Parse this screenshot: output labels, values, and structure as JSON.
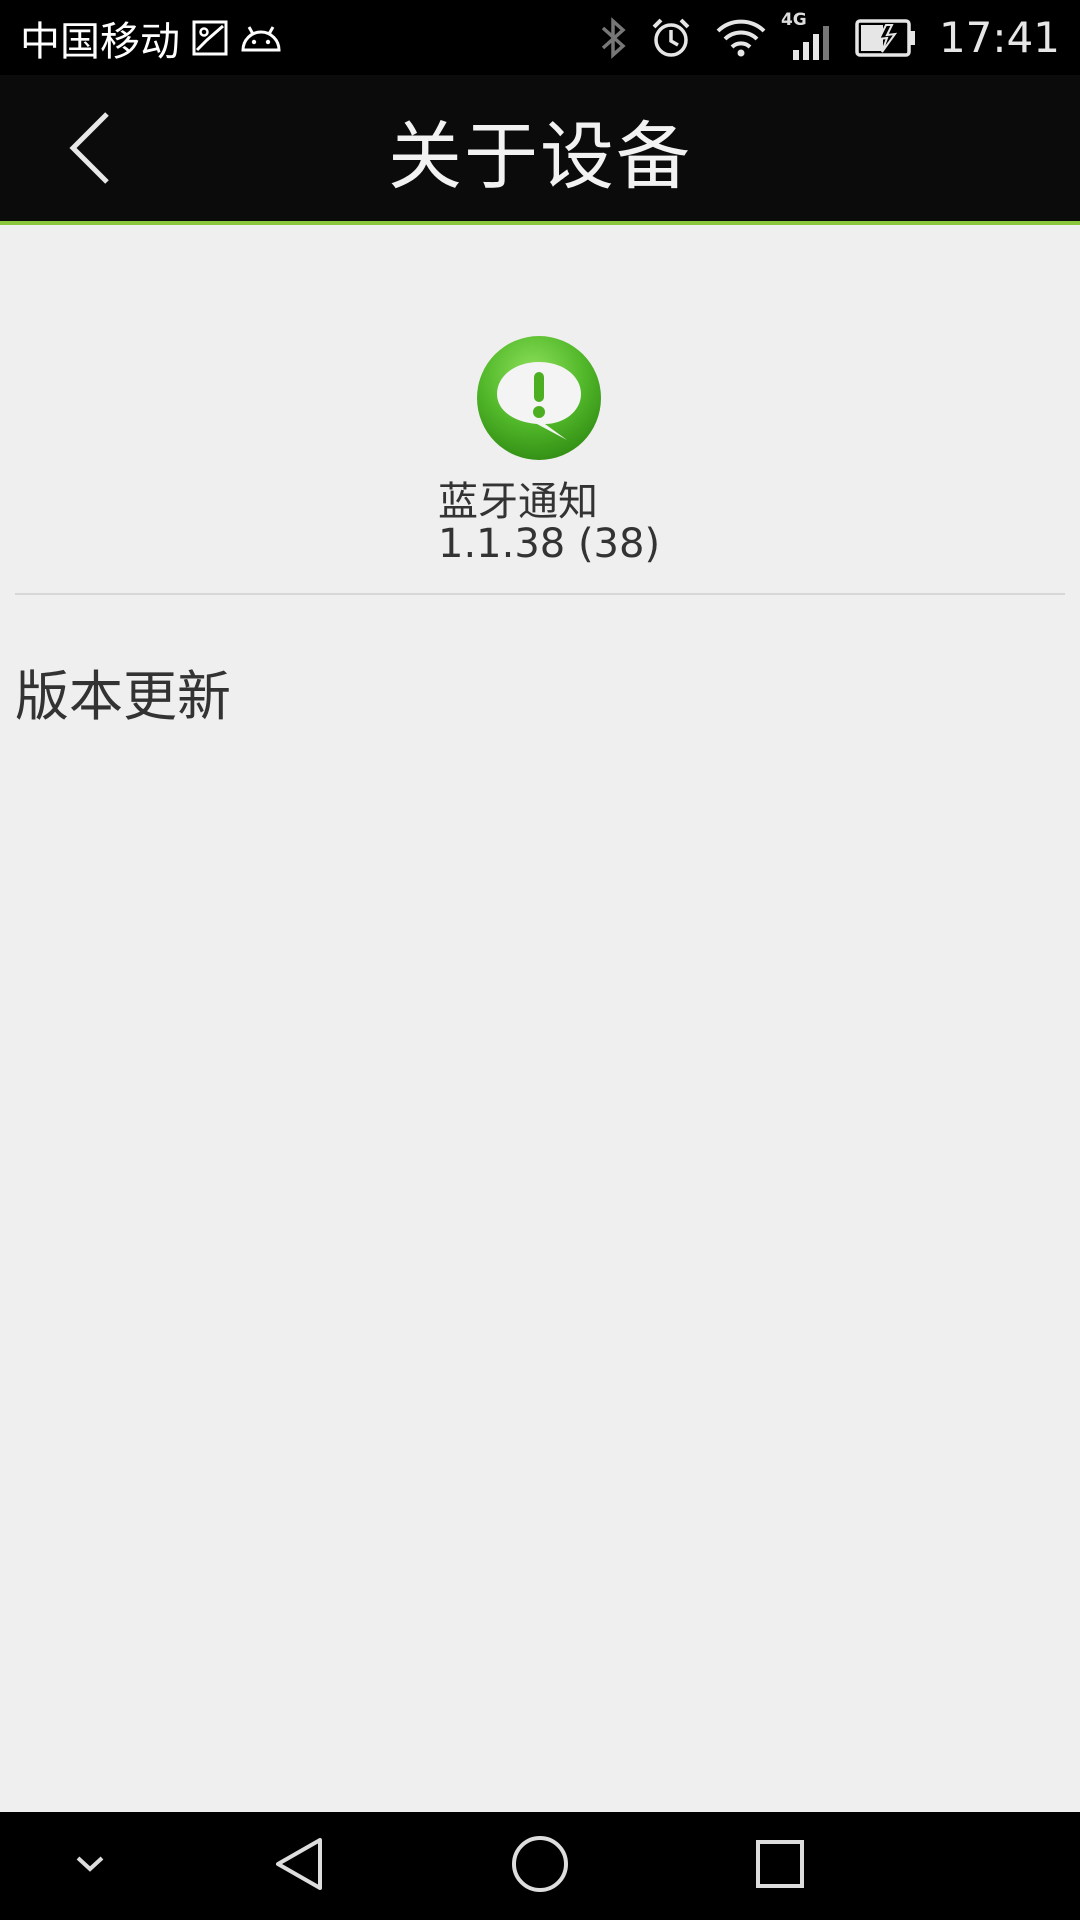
{
  "status_bar": {
    "carrier": "中国移动",
    "network_type": "4G",
    "time": "17:41",
    "icons": [
      "image-icon",
      "android-icon",
      "bluetooth-icon",
      "alarm-icon",
      "wifi-icon",
      "signal-icon",
      "battery-icon"
    ]
  },
  "app_bar": {
    "title": "关于设备",
    "back_icon": "back-arrow-icon",
    "accent_color": "#8cc63f"
  },
  "app_info": {
    "icon": "notification-bubble-icon",
    "icon_color": "#4caf22",
    "name": "蓝牙通知",
    "version": "1.1.38 (38)"
  },
  "menu": {
    "update_label": "版本更新"
  },
  "nav_bar": {
    "icons": [
      "collapse-icon",
      "back-icon",
      "home-icon",
      "recents-icon"
    ]
  }
}
